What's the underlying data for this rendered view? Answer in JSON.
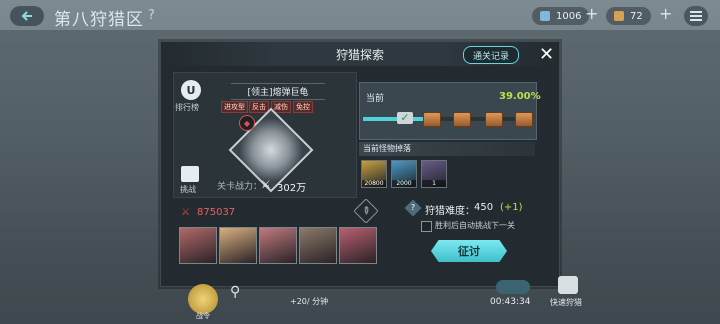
{
  "topbar": {
    "title": "第八狩猎区",
    "help": "?",
    "resource1_value": "1006",
    "resource2_value": "72"
  },
  "dialog": {
    "title": "狩猎探索",
    "record_button": "通关记录",
    "close": "✕",
    "rank_label": "排行榜",
    "challenge_label": "挑战",
    "boss_name": "[领主]熔弹巨龟",
    "tags": [
      "进攻型",
      "反击",
      "减伤",
      "免控"
    ],
    "power_label": "关卡战力：",
    "power_value": "302万",
    "progress": {
      "label": "当前",
      "percent": "39.00%",
      "fraction": 0.39
    },
    "drops_header": "当前怪物掉落",
    "drops": [
      {
        "count": "20800",
        "color": "#c9a040"
      },
      {
        "count": "2000",
        "color": "#4a9ac8"
      },
      {
        "count": "1",
        "color": "#6a5a8a"
      }
    ],
    "team_power": "875037",
    "heroes": [
      {
        "color": "#b06a6a"
      },
      {
        "color": "#d8b080"
      },
      {
        "color": "#c07a80"
      },
      {
        "color": "#8a7a6a"
      },
      {
        "color": "#b86070"
      }
    ],
    "difficulty_label": "狩猎难度：",
    "difficulty_value": "450",
    "difficulty_bonus": "(+1)",
    "auto_next_label": "胜利后自动挑战下一关",
    "attack_button": "征讨"
  },
  "bottombar": {
    "command_label": "战令",
    "rate": "+20/ 分钟",
    "timer": "00:43:34",
    "quick_hunt_label": "快速狩猎"
  },
  "colors": {
    "accent": "#4fd2d8",
    "progress_text": "#b8e04a",
    "danger": "#e05050"
  }
}
